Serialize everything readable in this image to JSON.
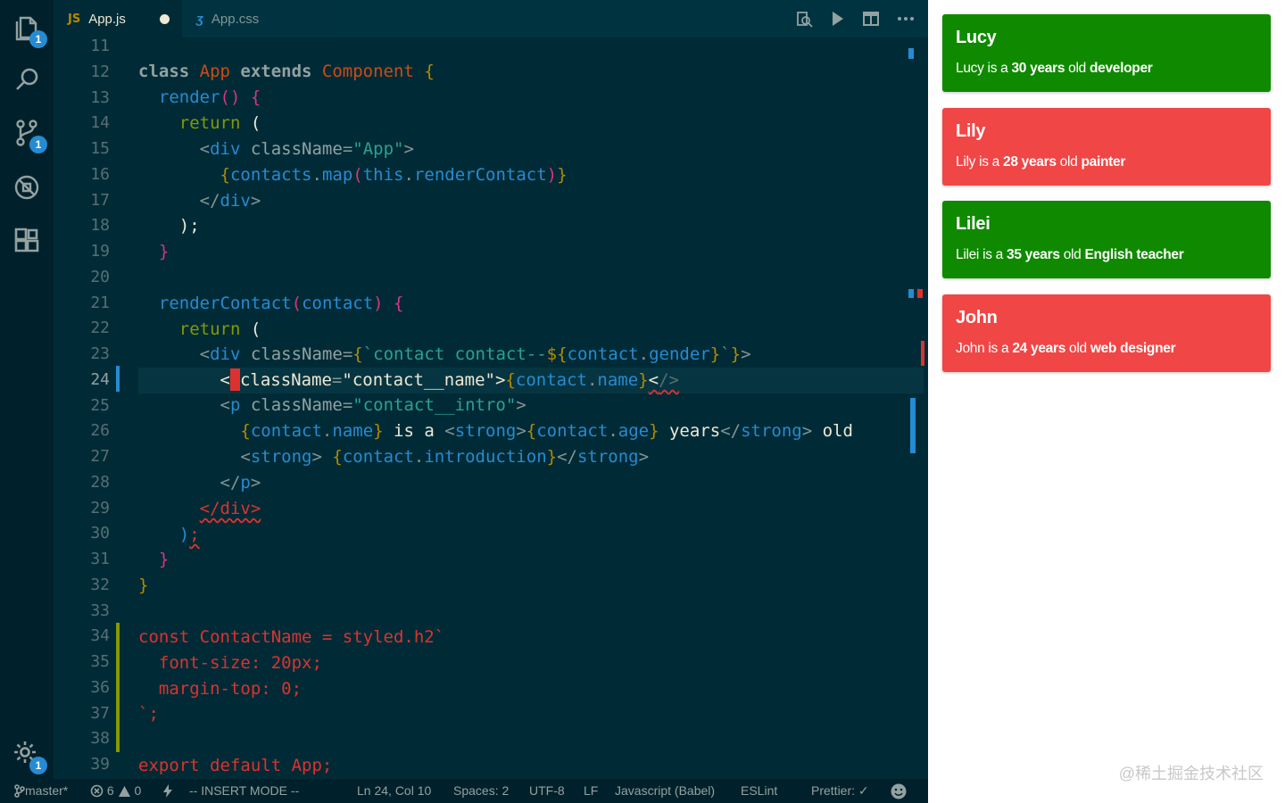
{
  "activity_bar": {
    "items": [
      {
        "name": "explorer",
        "badge": "1"
      },
      {
        "name": "search",
        "badge": ""
      },
      {
        "name": "source-control",
        "badge": "1"
      },
      {
        "name": "debug",
        "badge": ""
      },
      {
        "name": "extensions",
        "badge": ""
      }
    ],
    "settings_badge": "1"
  },
  "tabs": [
    {
      "label": "App.js",
      "type": "JS",
      "modified": true,
      "active": true
    },
    {
      "label": "App.css",
      "type": "CSS",
      "modified": false,
      "active": false
    }
  ],
  "editor": {
    "line_numbers": [
      "11",
      "12",
      "13",
      "14",
      "15",
      "16",
      "17",
      "18",
      "19",
      "20",
      "21",
      "22",
      "23",
      "24",
      "25",
      "26",
      "27",
      "28",
      "29",
      "30",
      "31",
      "32",
      "33",
      "34",
      "35",
      "36",
      "37",
      "38",
      "39"
    ],
    "current_line": "24",
    "lines": {
      "l12": {
        "kw": "class ",
        "name": "App",
        "ext": " extends ",
        "comp": "Component",
        "brace": " {"
      },
      "l13": {
        "fn": "render",
        "paren": "()",
        "brace": " {"
      },
      "l14": {
        "ret": "return",
        "paren": " ("
      },
      "l15": {
        "open": "<",
        "tag": "div",
        "attr": " className",
        "eq": "=",
        "str": "\"App\"",
        "close": ">"
      },
      "l16": {
        "b1": "{",
        "v1": "contacts",
        "d1": ".",
        "m1": "map",
        "p1": "(",
        "v2": "this",
        "d2": ".",
        "m2": "renderContact",
        "p2": ")",
        "b2": "}"
      },
      "l17": {
        "open": "</",
        "tag": "div",
        "close": ">"
      },
      "l18": {
        "text": ");"
      },
      "l19": {
        "text": "}"
      },
      "l21": {
        "fn": "renderContact",
        "p1": "(",
        "arg": "contact",
        "p2": ")",
        "brace": " {"
      },
      "l22": {
        "ret": "return",
        "paren": " ("
      },
      "l23": {
        "open": "<",
        "tag": "div",
        "attr": " className",
        "eq": "=",
        "b1": "{",
        "tick": "`",
        "str": "contact contact--",
        "interp": "${",
        "v1": "contact",
        "d1": ".",
        "v2": "gender",
        "ie": "}",
        "tick2": "`",
        "b2": "}",
        "close": ">"
      },
      "l24": {
        "open": "<",
        "attr": "className",
        "eq": "=",
        "str": "\"contact__name\"",
        "gt": ">",
        "b1": "{",
        "v1": "contact",
        "d1": ".",
        "v2": "name",
        "b2": "}",
        "lt": "<",
        "slash": "/>"
      },
      "l25": {
        "open": "<",
        "tag": "p",
        "attr": " className",
        "eq": "=",
        "str": "\"contact__intro\"",
        "close": ">"
      },
      "l26": {
        "b1": "{",
        "v1": "contact",
        "d1": ".",
        "v2": "name",
        "b2": "}",
        "t1": " is a ",
        "o1": "<",
        "s1": "strong",
        "c1": ">",
        "b3": "{",
        "v3": "contact",
        "d2": ".",
        "v4": "age",
        "b4": "}",
        "t2": " years",
        "o2": "</",
        "s2": "strong",
        "c2": ">",
        "t3": " old"
      },
      "l27": {
        "o1": "<",
        "s1": "strong",
        "c1": "> ",
        "b1": "{",
        "v1": "contact",
        "d1": ".",
        "v2": "introduction",
        "b2": "}",
        "o2": "</",
        "s2": "strong",
        "c2": ">"
      },
      "l28": {
        "open": "</",
        "tag": "p",
        "close": ">"
      },
      "l29": {
        "text": "</div>"
      },
      "l30": {
        "p": ")",
        "semi": ";"
      },
      "l31": {
        "text": "}"
      },
      "l32": {
        "text": "}"
      },
      "l34": {
        "text": "const ContactName = styled.h2`"
      },
      "l35": {
        "text": "font-size: 20px;"
      },
      "l36": {
        "text": "margin-top: 0;"
      },
      "l37": {
        "text": "`;"
      },
      "l39": {
        "text": "export default App;"
      }
    }
  },
  "status_bar": {
    "branch": "master*",
    "errors": "6",
    "warnings": "0",
    "mode": "-- INSERT MODE --",
    "position": "Ln 24, Col 10",
    "spaces": "Spaces: 2",
    "encoding": "UTF-8",
    "eol": "LF",
    "language": "Javascript (Babel)",
    "linter": "ESLint",
    "prettier": "Prettier: ✓"
  },
  "preview": {
    "contacts": [
      {
        "name": "Lucy",
        "intro_prefix": "Lucy is a ",
        "age_text": "30 years",
        "mid": " old ",
        "job": "developer",
        "gender": "female",
        "color": "#0f8a00"
      },
      {
        "name": "Lily",
        "intro_prefix": "Lily is a ",
        "age_text": "28 years",
        "mid": " old ",
        "job": "painter",
        "gender": "male",
        "color": "#f04646"
      },
      {
        "name": "Lilei",
        "intro_prefix": "Lilei is a ",
        "age_text": "35 years",
        "mid": " old ",
        "job": "English teacher",
        "gender": "female",
        "color": "#0f8a00"
      },
      {
        "name": "John",
        "intro_prefix": "John is a ",
        "age_text": "24 years",
        "mid": " old ",
        "job": "web designer",
        "gender": "male",
        "color": "#f04646"
      }
    ],
    "watermark": "@稀土掘金技术社区"
  }
}
